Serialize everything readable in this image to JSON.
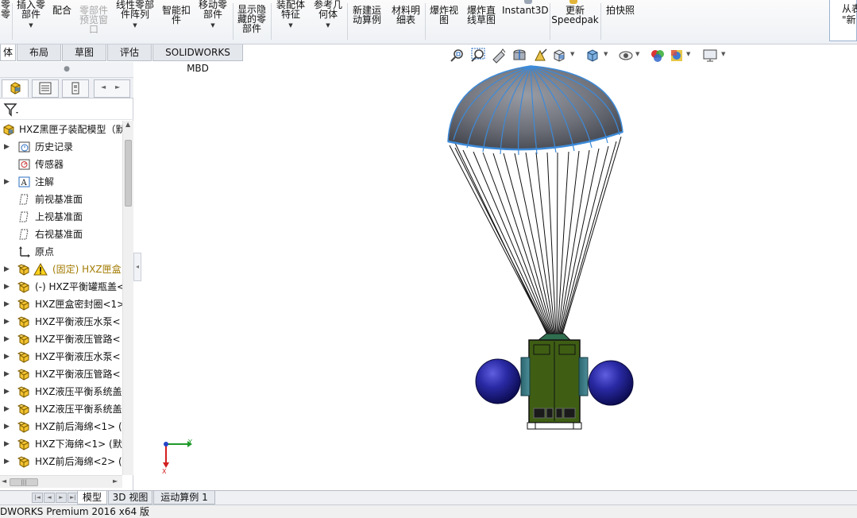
{
  "ribbon": {
    "buttons": [
      {
        "label": "零\n零",
        "disabled": false
      },
      {
        "label": "插入零\n部件",
        "disabled": false
      },
      {
        "label": "配合",
        "disabled": false
      },
      {
        "label": "零部件\n预览窗\n口",
        "disabled": true
      },
      {
        "label": "线性零部\n件阵列",
        "disabled": false
      },
      {
        "label": "智能扣\n件",
        "disabled": false
      },
      {
        "label": "移动零\n部件",
        "disabled": false
      },
      {
        "label": "显示隐\n藏的零\n部件",
        "disabled": false
      },
      {
        "label": "装配体\n特征",
        "disabled": false
      },
      {
        "label": "参考几\n何体",
        "disabled": false
      },
      {
        "label": "新建运\n动算例",
        "disabled": false
      },
      {
        "label": "材料明\n细表",
        "disabled": false
      },
      {
        "label": "爆炸视\n图",
        "disabled": false
      },
      {
        "label": "爆炸直\n线草图",
        "disabled": false
      },
      {
        "label": "Instant3D",
        "disabled": false
      },
      {
        "label": "更新\nSpeedpak",
        "disabled": false
      },
      {
        "label": "拍快照",
        "disabled": false
      }
    ],
    "right_panel_label": "从表\n\"新"
  },
  "command_tabs": [
    "体",
    "布局",
    "草图",
    "评估",
    "SOLIDWORKS MBD"
  ],
  "hud_icons": [
    "zoom-to-fit-icon",
    "zoom-to-area-icon",
    "previous-view-icon",
    "section-view-icon",
    "dynamic-annotation-icon",
    "view-orientation-icon",
    "display-style-icon",
    "hide-show-items-icon",
    "edit-appearance-icon",
    "apply-scene-icon",
    "view-settings-icon"
  ],
  "feature_manager": {
    "panel_tabs": [
      "featuremanager-tab",
      "propertymanager-tab",
      "configurationmanager-tab"
    ],
    "tree": [
      {
        "label": "HXZ黑匣子装配模型（默",
        "icon": "assembly-icon",
        "expander": false,
        "indent": 0,
        "warn": false
      },
      {
        "label": "历史记录",
        "icon": "history-icon",
        "expander": true,
        "indent": 1,
        "warn": false
      },
      {
        "label": "传感器",
        "icon": "sensor-icon",
        "expander": false,
        "indent": 1,
        "warn": false
      },
      {
        "label": "注解",
        "icon": "annotation-icon",
        "expander": true,
        "indent": 1,
        "warn": false
      },
      {
        "label": "前视基准面",
        "icon": "plane-icon",
        "expander": false,
        "indent": 1,
        "warn": false
      },
      {
        "label": "上视基准面",
        "icon": "plane-icon",
        "expander": false,
        "indent": 1,
        "warn": false
      },
      {
        "label": "右视基准面",
        "icon": "plane-icon",
        "expander": false,
        "indent": 1,
        "warn": false
      },
      {
        "label": "原点",
        "icon": "origin-icon",
        "expander": false,
        "indent": 1,
        "warn": false
      },
      {
        "label": "(固定) HXZ匣盒",
        "icon": "part-icon",
        "expander": true,
        "indent": 1,
        "warn": true
      },
      {
        "label": "(-) HXZ平衡罐瓶盖<",
        "icon": "part-icon",
        "expander": true,
        "indent": 1,
        "warn": false
      },
      {
        "label": "HXZ匣盒密封圈<1>",
        "icon": "part-icon",
        "expander": true,
        "indent": 1,
        "warn": false
      },
      {
        "label": "HXZ平衡液压水泵<",
        "icon": "part-icon",
        "expander": true,
        "indent": 1,
        "warn": false
      },
      {
        "label": "HXZ平衡液压管路<",
        "icon": "part-icon",
        "expander": true,
        "indent": 1,
        "warn": false
      },
      {
        "label": "HXZ平衡液压水泵<",
        "icon": "part-icon",
        "expander": true,
        "indent": 1,
        "warn": false
      },
      {
        "label": "HXZ平衡液压管路<",
        "icon": "part-icon",
        "expander": true,
        "indent": 1,
        "warn": false
      },
      {
        "label": "HXZ液压平衡系统盖",
        "icon": "part-icon",
        "expander": true,
        "indent": 1,
        "warn": false
      },
      {
        "label": "HXZ液压平衡系统盖",
        "icon": "part-icon",
        "expander": true,
        "indent": 1,
        "warn": false
      },
      {
        "label": "HXZ前后海绵<1> (",
        "icon": "part-icon",
        "expander": true,
        "indent": 1,
        "warn": false
      },
      {
        "label": "HXZ下海绵<1> (默",
        "icon": "part-icon",
        "expander": true,
        "indent": 1,
        "warn": false
      },
      {
        "label": "HXZ前后海绵<2> (",
        "icon": "part-icon",
        "expander": true,
        "indent": 1,
        "warn": false
      }
    ]
  },
  "triad": {
    "y_label": "Y",
    "x_label": "X"
  },
  "bottom_tabs": [
    "模型",
    "3D 视图",
    "运动算例 1"
  ],
  "status_text": "DWORKS Premium 2016 x64 版",
  "colors": {
    "accent": "#3b82c4",
    "canopy": "#6d7079",
    "box_green": "#3f5e14",
    "float_blue": "#27279a"
  }
}
